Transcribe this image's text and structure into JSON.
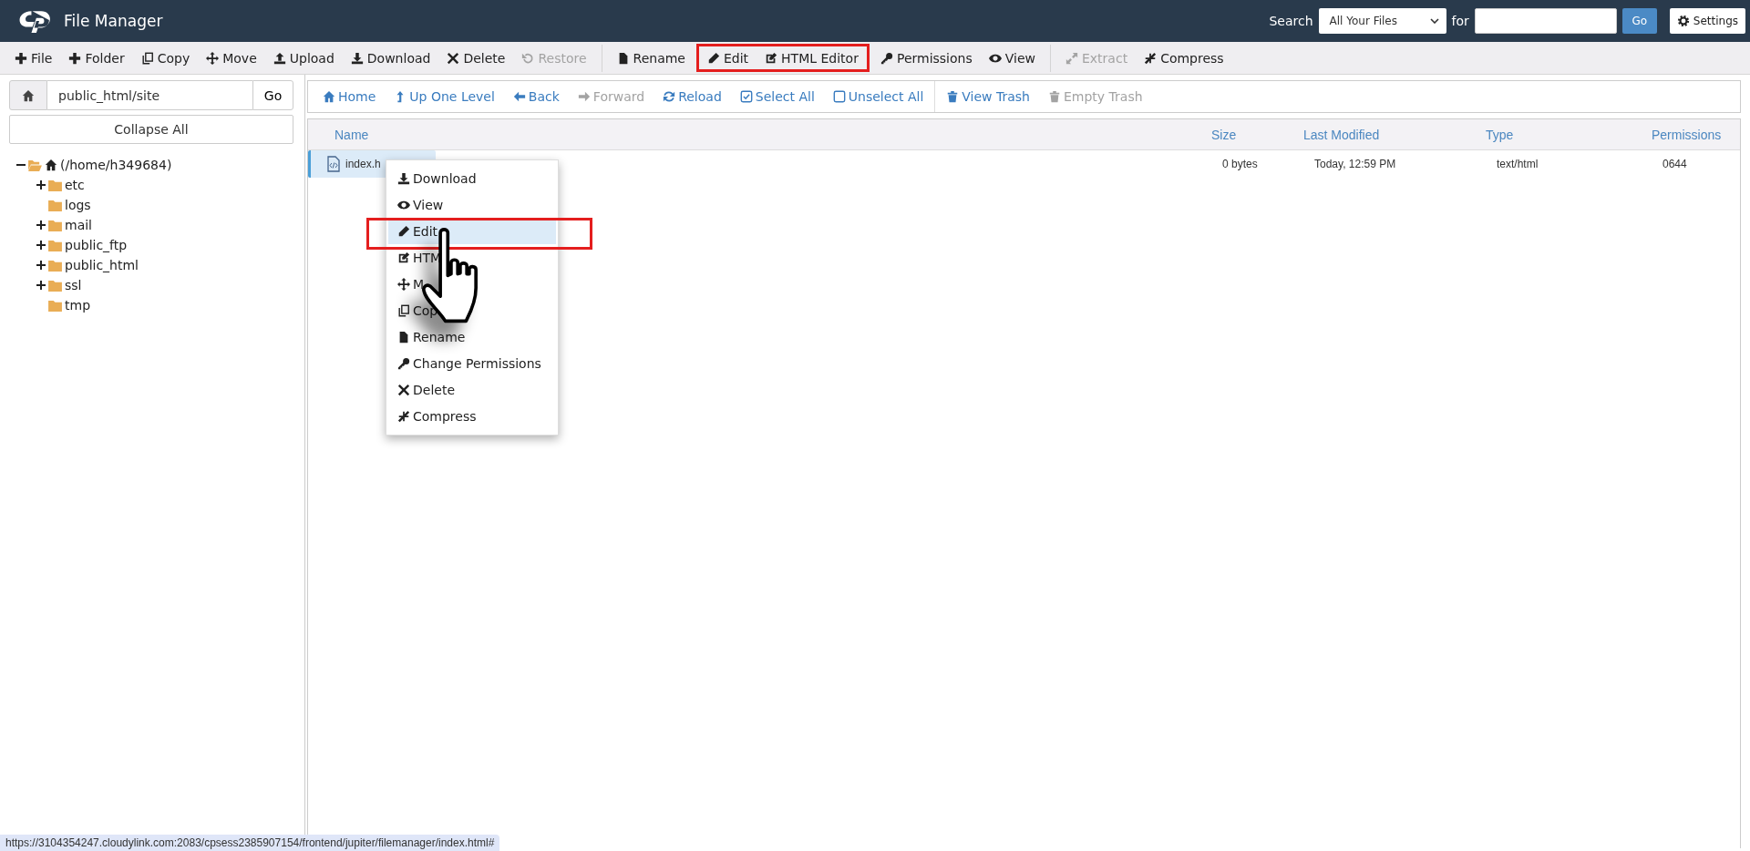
{
  "header": {
    "title": "File Manager",
    "search_label": "Search",
    "search_scope": "All Your Files",
    "for_label": "for",
    "go": "Go",
    "settings": "Settings"
  },
  "toolbar": {
    "sections": [
      {
        "groups": [
          {
            "highlighted": false,
            "items": [
              {
                "label": "File",
                "kind": "plus",
                "disabled": false
              },
              {
                "label": "Folder",
                "kind": "plus",
                "disabled": false
              },
              {
                "label": "Copy",
                "kind": "copy",
                "disabled": false
              },
              {
                "label": "Move",
                "kind": "move",
                "disabled": false
              },
              {
                "label": "Upload",
                "kind": "upload",
                "disabled": false
              },
              {
                "label": "Download",
                "kind": "download",
                "disabled": false
              },
              {
                "label": "Delete",
                "kind": "cross",
                "disabled": false
              },
              {
                "label": "Restore",
                "kind": "undo",
                "disabled": true
              }
            ]
          }
        ]
      },
      {
        "groups": [
          {
            "highlighted": false,
            "items": [
              {
                "label": "Rename",
                "kind": "file",
                "disabled": false
              }
            ]
          },
          {
            "highlighted": true,
            "items": [
              {
                "label": "Edit",
                "kind": "pencil",
                "disabled": false
              },
              {
                "label": "HTML Editor",
                "kind": "edit",
                "disabled": false
              }
            ]
          },
          {
            "highlighted": false,
            "items": [
              {
                "label": "Permissions",
                "kind": "key",
                "disabled": false
              },
              {
                "label": "View",
                "kind": "eye",
                "disabled": false
              }
            ]
          }
        ]
      },
      {
        "groups": [
          {
            "highlighted": false,
            "items": [
              {
                "label": "Extract",
                "kind": "expand",
                "disabled": true
              },
              {
                "label": "Compress",
                "kind": "compress",
                "disabled": false
              }
            ]
          }
        ]
      }
    ]
  },
  "path_bar": {
    "value": "public_html/site",
    "go": "Go"
  },
  "collapse_all": "Collapse All",
  "tree": [
    {
      "label": "(/home/h349684)",
      "has_children": true,
      "expanded": true,
      "home": true,
      "children": [
        {
          "label": "etc",
          "has_children": true,
          "expanded": false,
          "home": false
        },
        {
          "label": "logs",
          "has_children": false,
          "expanded": false,
          "home": false
        },
        {
          "label": "mail",
          "has_children": true,
          "expanded": false,
          "home": false
        },
        {
          "label": "public_ftp",
          "has_children": true,
          "expanded": false,
          "home": false
        },
        {
          "label": "public_html",
          "has_children": true,
          "expanded": false,
          "home": false
        },
        {
          "label": "ssl",
          "has_children": true,
          "expanded": false,
          "home": false
        },
        {
          "label": "tmp",
          "has_children": false,
          "expanded": false,
          "home": false
        }
      ]
    }
  ],
  "nav": {
    "sections": [
      {
        "items": [
          {
            "label": "Home",
            "kind": "home",
            "disabled": false
          },
          {
            "label": "Up One Level",
            "kind": "up",
            "disabled": false
          },
          {
            "label": "Back",
            "kind": "left",
            "disabled": false
          },
          {
            "label": "Forward",
            "kind": "right",
            "disabled": true
          },
          {
            "label": "Reload",
            "kind": "reload",
            "disabled": false
          },
          {
            "label": "Select All",
            "kind": "checkbox",
            "disabled": false
          },
          {
            "label": "Unselect All",
            "kind": "square",
            "disabled": false
          }
        ]
      },
      {
        "items": [
          {
            "label": "View Trash",
            "kind": "trash",
            "disabled": false
          },
          {
            "label": "Empty Trash",
            "kind": "trash",
            "disabled": true
          }
        ]
      }
    ]
  },
  "table": {
    "columns": [
      "Name",
      "Size",
      "Last Modified",
      "Type",
      "Permissions"
    ],
    "rows": [
      {
        "selected": true,
        "name": "index.h",
        "size": "0 bytes",
        "modified": "Today, 12:59 PM",
        "type": "text/html",
        "permissions": "0644"
      }
    ]
  },
  "context_menu": [
    {
      "label": "Download",
      "kind": "download",
      "selected": false,
      "highlighted": false
    },
    {
      "label": "View",
      "kind": "eye",
      "selected": false,
      "highlighted": false
    },
    {
      "label": "Edit",
      "kind": "pencil",
      "selected": true,
      "highlighted": true
    },
    {
      "label": "HTM",
      "kind": "edit",
      "selected": false,
      "highlighted": false
    },
    {
      "label": "M",
      "kind": "move",
      "selected": false,
      "highlighted": false
    },
    {
      "label": "Cop",
      "kind": "copy",
      "selected": false,
      "highlighted": false
    },
    {
      "label": "Rename",
      "kind": "file",
      "selected": false,
      "highlighted": false
    },
    {
      "label": "Change Permissions",
      "kind": "key",
      "selected": false,
      "highlighted": false
    },
    {
      "label": "Delete",
      "kind": "cross",
      "selected": false,
      "highlighted": false
    },
    {
      "label": "Compress",
      "kind": "compress",
      "selected": false,
      "highlighted": false
    }
  ],
  "status_url": "https://3104354247.cloudylink.com:2083/cpsess2385907154/frontend/jupiter/filemanager/index.html#"
}
